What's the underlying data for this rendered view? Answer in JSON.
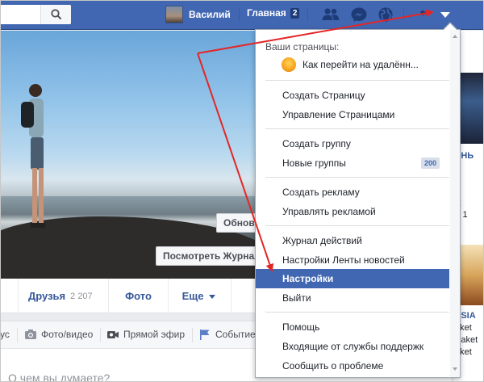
{
  "topbar": {
    "user_name": "Василий",
    "home_label": "Главная",
    "home_badge": "2",
    "icons": [
      "search-icon",
      "friends-icon",
      "messenger-icon",
      "globe-icon",
      "account-menu-caret-icon"
    ]
  },
  "cover": {
    "update_button": "Обнов",
    "view_log_button": "Посмотреть Журнал"
  },
  "tabs": {
    "friends_label": "Друзья",
    "friends_count": "2 207",
    "photos_label": "Фото",
    "more_label": "Еще"
  },
  "composer": {
    "status_label": "ус",
    "photo_video_label": "Фото/видео",
    "live_label": "Прямой эфир",
    "event_label": "Событие",
    "placeholder": "О чем вы думаете?"
  },
  "right_col": {
    "line1": "ЕНЬ",
    "line2": "R",
    "line3": "л 1",
    "line4": "ESIA",
    "line5": "aket",
    "line6": "Paket",
    "line7": "aket",
    "line8": "к"
  },
  "dropdown": {
    "your_pages_header": "Ваши страницы:",
    "page_name": "Как перейти на удалённ...",
    "create_page": "Создать Страницу",
    "manage_pages": "Управление Страницами",
    "create_group": "Создать группу",
    "new_groups": "Новые группы",
    "new_groups_count": "200",
    "create_ad": "Создать рекламу",
    "manage_ads": "Управлять рекламой",
    "activity_log": "Журнал действий",
    "news_feed_prefs": "Настройки Ленты новостей",
    "settings": "Настройки",
    "logout": "Выйти",
    "help": "Помощь",
    "support_inbox": "Входящие от службы поддержк",
    "report_problem": "Сообщить о проблеме"
  },
  "colors": {
    "brand": "#4267b2",
    "annotation_arrow": "#e32626"
  }
}
